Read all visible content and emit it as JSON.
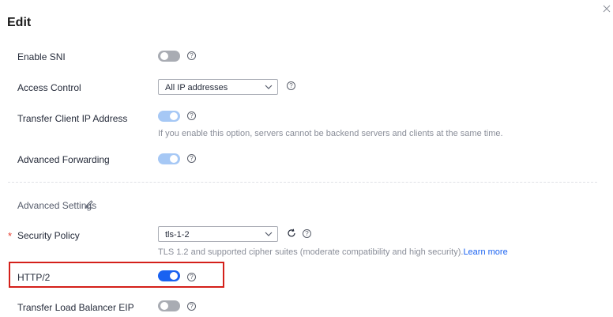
{
  "dialog": {
    "title": "Edit"
  },
  "rows": {
    "enable_sni": {
      "label": "Enable SNI",
      "state": "off"
    },
    "access_control": {
      "label": "Access Control",
      "selected": "All IP addresses"
    },
    "transfer_client_ip": {
      "label": "Transfer Client IP Address",
      "state": "on-disabled",
      "hint": "If you enable this option, servers cannot be backend servers and clients at the same time."
    },
    "advanced_forwarding": {
      "label": "Advanced Forwarding",
      "state": "on-disabled"
    },
    "advanced_settings": {
      "label": "Advanced Settings"
    },
    "security_policy": {
      "required_mark": "*",
      "label": "Security Policy",
      "selected": "tls-1-2",
      "hint": "TLS 1.2 and supported cipher suites (moderate compatibility and high security).",
      "link": "Learn more"
    },
    "http2": {
      "label": "HTTP/2",
      "state": "on"
    },
    "transfer_eip": {
      "label": "Transfer Load Balancer EIP",
      "state": "off"
    }
  },
  "help_glyph": "?",
  "colors": {
    "toggle_on": "#1a62f1",
    "toggle_on_disabled": "#a6c8f5",
    "toggle_off": "#a9acb3",
    "required": "#e53e30",
    "highlight_box": "#d4201a",
    "link": "#1a62f1"
  },
  "icons": [
    "close-icon",
    "help-icon",
    "chevron-down-icon",
    "edit-icon",
    "refresh-icon"
  ]
}
